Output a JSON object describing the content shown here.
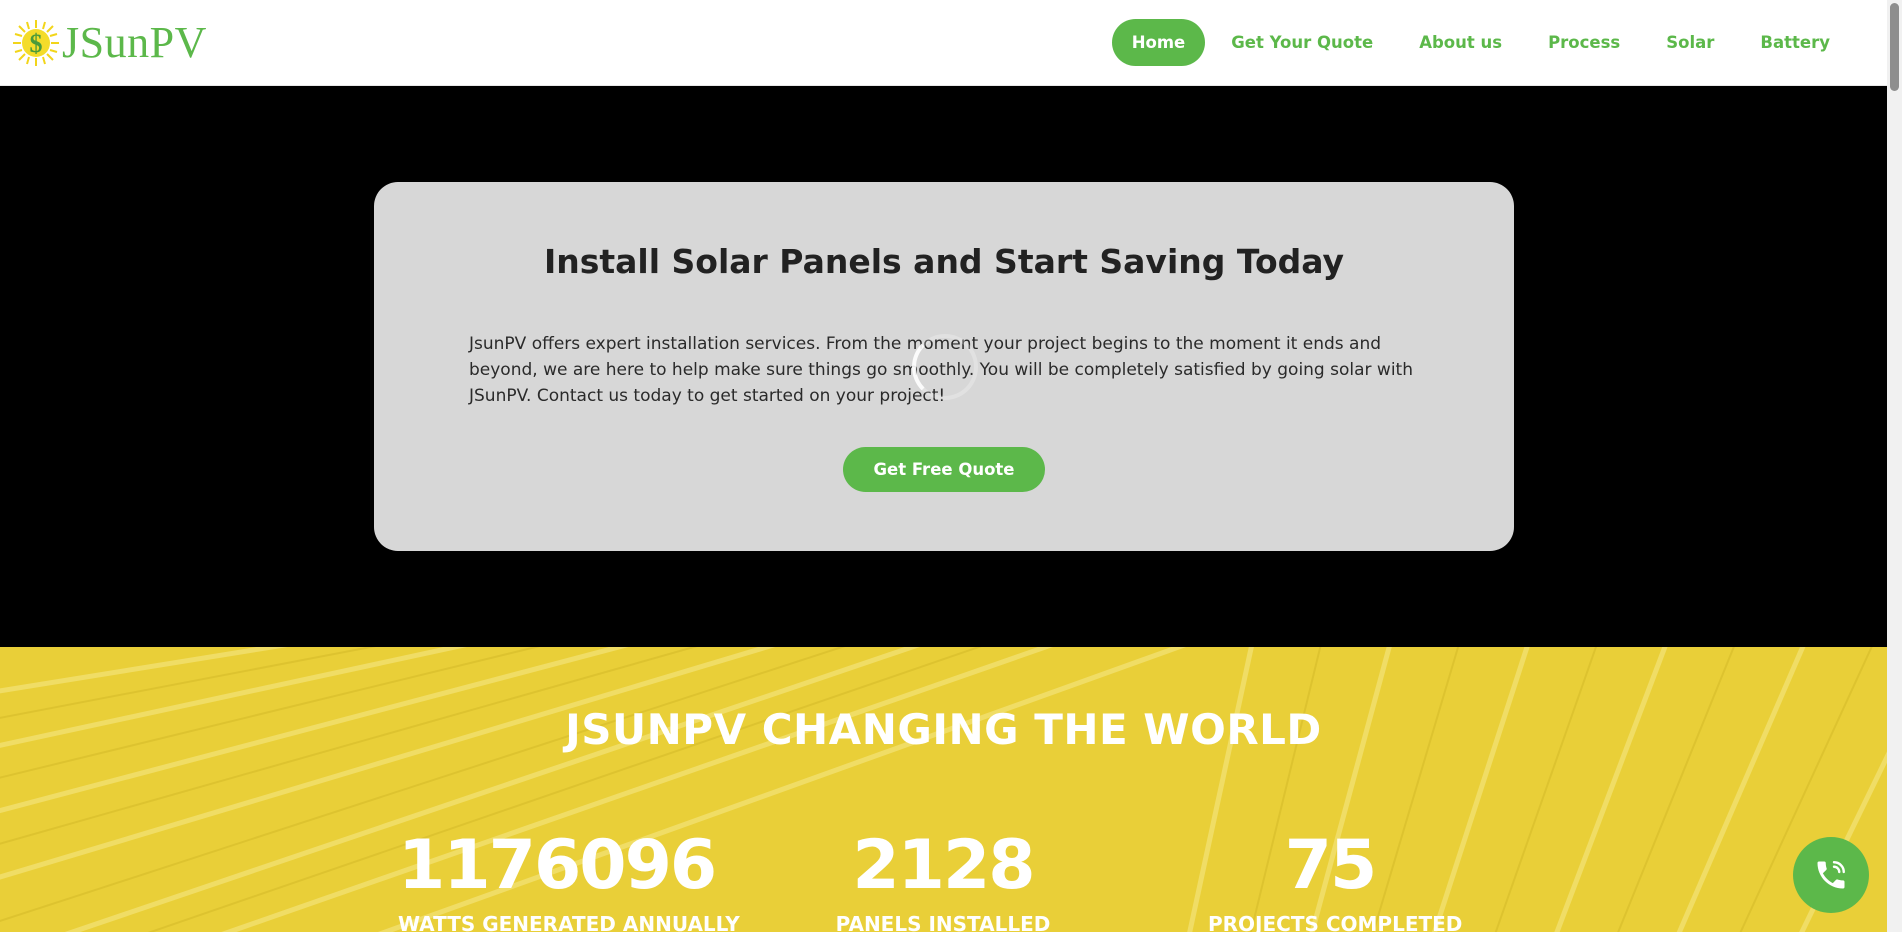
{
  "header": {
    "logo_text": "JSunPV",
    "nav": [
      {
        "label": "Home",
        "active": true
      },
      {
        "label": "Get Your Quote"
      },
      {
        "label": "About us"
      },
      {
        "label": "Process"
      },
      {
        "label": "Solar"
      },
      {
        "label": "Battery"
      }
    ]
  },
  "hero": {
    "title": "Install Solar Panels and Start Saving Today",
    "text": "JsunPV offers expert installation services. From the moment your project begins to the moment it ends and beyond, we are here to help make sure things go smoothly. You will be completely satisfied by going solar with JSunPV. Contact us today to get started on your project!",
    "cta_label": "Get Free Quote"
  },
  "stats": {
    "title": "JSUNPV CHANGING THE WORLD",
    "items": [
      {
        "value": "1176096",
        "label": "WATTS GENERATED ANNUALLY"
      },
      {
        "value": "2128",
        "label": "PANELS INSTALLED"
      },
      {
        "value": "75",
        "label": "PROJECTS COMPLETED"
      }
    ]
  },
  "colors": {
    "brand_green": "#5cb84a",
    "hero_bg": "#000000",
    "card_bg": "#d7d7d7",
    "stats_yellow": "#e8cf3a"
  },
  "icons": {
    "logo": "dollar-sun-icon",
    "spinner": "loading-spinner-icon",
    "phone": "phone-call-icon"
  }
}
